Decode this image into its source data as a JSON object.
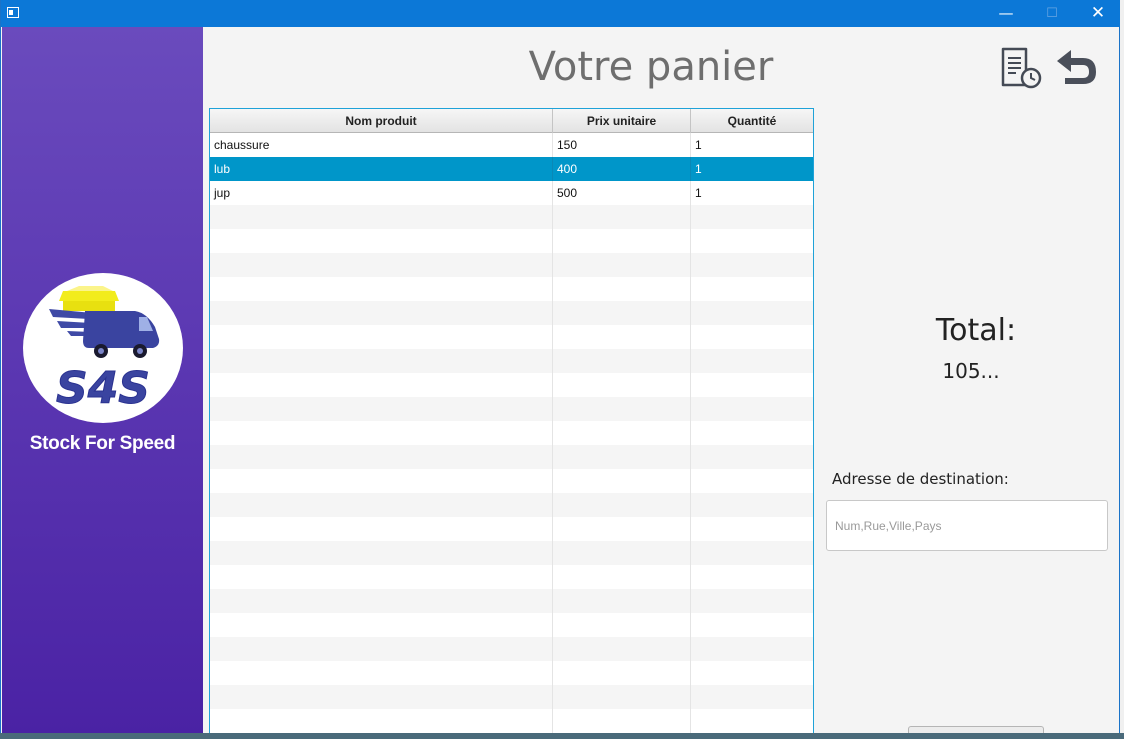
{
  "window": {
    "minimize_glyph": "—",
    "maximize_glyph": "☐",
    "close_glyph": "✕"
  },
  "sidebar": {
    "logo_text": "S4S",
    "brand_name": "Stock For Speed"
  },
  "header": {
    "title": "Votre panier",
    "history_icon": "history-document-icon",
    "back_icon": "back-arrow-icon"
  },
  "cart_table": {
    "columns": [
      "Nom produit",
      "Prix unitaire",
      "Quantité"
    ],
    "rows": [
      {
        "name": "chaussure",
        "price": "150",
        "qty": "1"
      },
      {
        "name": "lub",
        "price": "400",
        "qty": "1"
      },
      {
        "name": "jup",
        "price": "500",
        "qty": "1"
      }
    ],
    "selected_row": 1,
    "empty_rows": 22
  },
  "summary": {
    "total_label": "Total:",
    "total_value": "105..."
  },
  "address": {
    "label": "Adresse de destination:",
    "value": "",
    "placeholder": "Num,Rue,Ville,Pays"
  },
  "colors": {
    "titlebar": "#0c78d7",
    "sidebar_top": "#6a4bbd",
    "sidebar_bottom": "#4a22a4",
    "selection": "#0096c9",
    "table_border": "#1fa2d8"
  }
}
